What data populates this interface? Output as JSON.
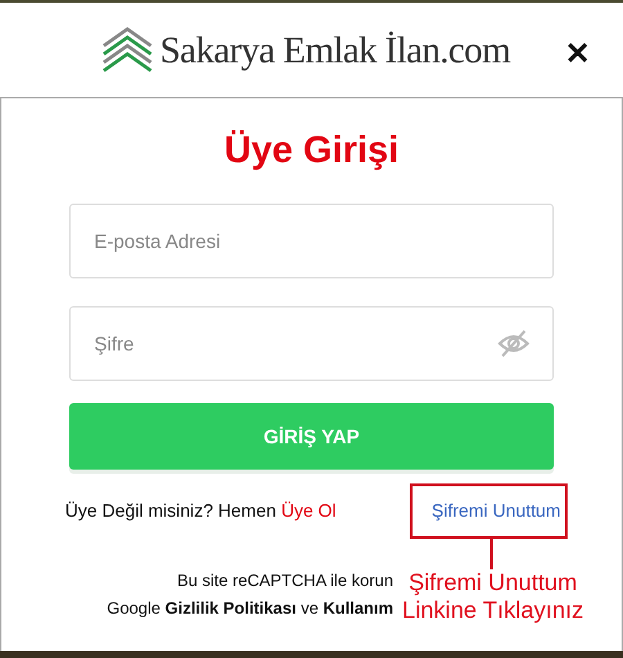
{
  "header": {
    "logo_text": "Sakarya Emlak İlan.com",
    "close": "✕"
  },
  "login": {
    "title": "Üye Girişi",
    "fields": [
      {
        "kind": "text",
        "placeholder": "E-posta Adresi"
      },
      {
        "kind": "password",
        "placeholder": "Şifre"
      }
    ],
    "submit": "GİRİŞ YAP",
    "signup_text": "Üye Değil misiniz? Hemen",
    "signup_link": "Üye Ol",
    "forgot_link": "Şifremi Unuttum",
    "recaptcha": [
      "Bu site reCAPTCHA ile korun",
      "Google **Gizlilik Politikası** ve **Kullanım**"
    ]
  },
  "annotation": {
    "text": [
      "Şifremi Unuttum",
      "Linkine Tıklayınız"
    ]
  }
}
